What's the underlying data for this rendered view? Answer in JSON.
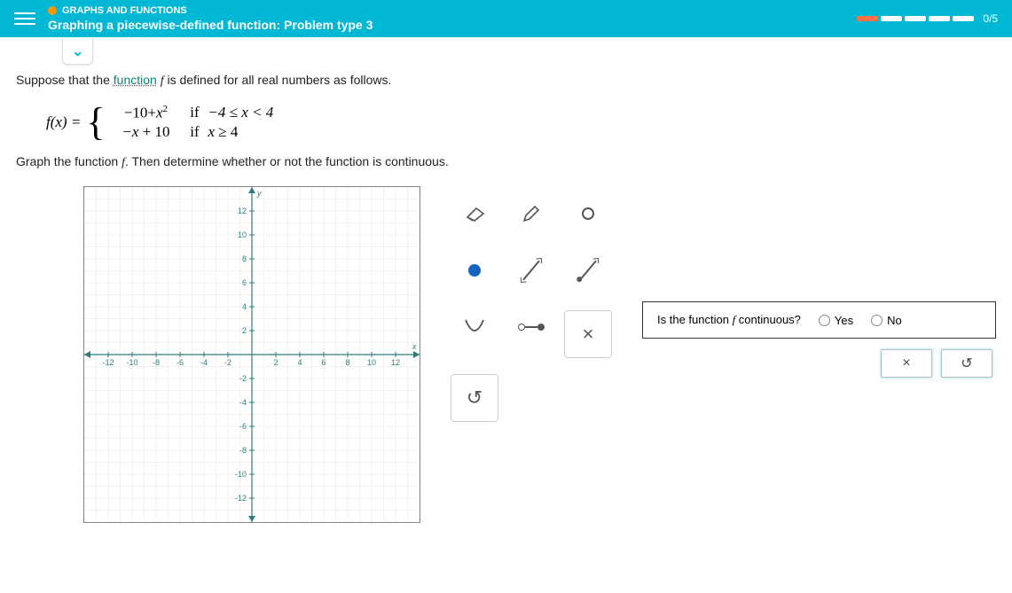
{
  "header": {
    "breadcrumb": "GRAPHS AND FUNCTIONS",
    "title": "Graphing a piecewise-defined function: Problem type 3",
    "progress": "0/5"
  },
  "prompt": {
    "intro_before": "Suppose that the ",
    "link_text": "function",
    "intro_after": " is defined for all real numbers as follows.",
    "func_letter": "f"
  },
  "equation": {
    "lhs": "f(x) =",
    "pieces": [
      {
        "expr_pre": "−10+",
        "var": "x",
        "sup": "2",
        "if": "if",
        "cond": "−4 ≤ x < 4"
      },
      {
        "expr": "−x + 10",
        "if": "if",
        "cond": "x ≥ 4"
      }
    ]
  },
  "instruction": "Graph the function f. Then determine whether or not the function is continuous.",
  "graph": {
    "xmin": -14,
    "xmax": 14,
    "ymin": -14,
    "ymax": 14,
    "xticks": [
      -12,
      -10,
      -8,
      -6,
      -4,
      -2,
      2,
      4,
      6,
      8,
      10,
      12
    ],
    "yticks": [
      -12,
      -10,
      -8,
      -6,
      -4,
      -2,
      2,
      4,
      6,
      8,
      10,
      12
    ],
    "xlabel": "x",
    "ylabel": "y"
  },
  "tools": {
    "eraser": "eraser",
    "pencil": "pencil",
    "open_point": "open-point",
    "closed_point": "closed-point",
    "line": "line",
    "ray": "ray",
    "parabola": "parabola",
    "segment": "segment",
    "clear": "×",
    "reset": "↺"
  },
  "question": {
    "text": "Is the function f continuous?",
    "yes": "Yes",
    "no": "No"
  },
  "buttons": {
    "clear": "×",
    "reset": "↺"
  }
}
